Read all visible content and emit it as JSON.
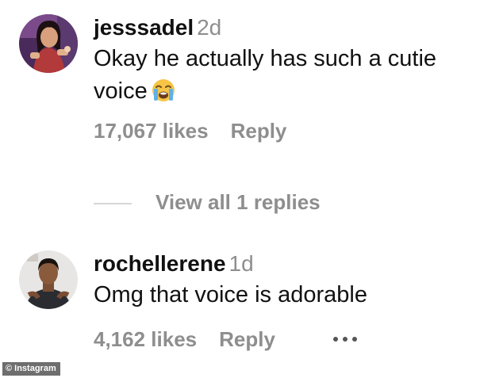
{
  "comments": [
    {
      "username": "jesssadel",
      "time": "2d",
      "text_line1": "Okay he actually has such a cutie",
      "text_line2": "voice",
      "emoji": "loudly-crying-face",
      "likes": "17,067 likes",
      "reply": "Reply"
    },
    {
      "username": "rochellerene",
      "time": "1d",
      "text": "Omg that voice is adorable",
      "likes": "4,162 likes",
      "reply": "Reply",
      "more_icon": "more-options-icon"
    }
  ],
  "view_replies": "View all 1 replies",
  "watermark": "© Instagram",
  "colors": {
    "primary_text": "#111111",
    "secondary_text": "#8e8e8e",
    "divider": "#d6d6d6",
    "background": "#ffffff"
  }
}
